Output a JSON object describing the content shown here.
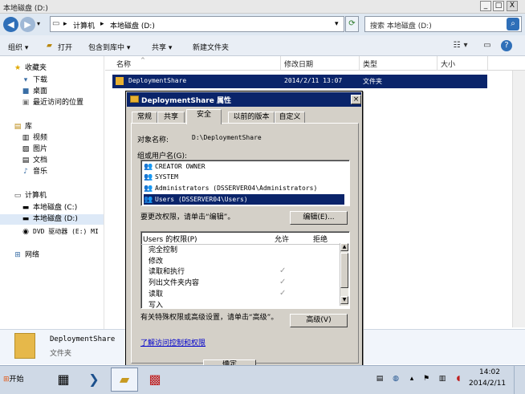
{
  "window": {
    "title": "本地磁盘 (D:)",
    "min": "_",
    "max": "□",
    "close": "X"
  },
  "address": {
    "crumbs": [
      "▸",
      "计算机",
      "▸",
      "本地磁盘 (D:)",
      "▾"
    ],
    "search_placeholder": "搜索 本地磁盘 (D:)"
  },
  "toolbar": {
    "organize": "组织 ▾",
    "open": "打开",
    "include": "包含到库中 ▾",
    "share": "共享 ▾",
    "new_folder": "新建文件夹"
  },
  "sidebar": {
    "favorites": "收藏夹",
    "fav_items": [
      "下载",
      "桌面",
      "最近访问的位置"
    ],
    "libraries": "库",
    "lib_items": [
      "视频",
      "图片",
      "文档",
      "音乐"
    ],
    "computer": "计算机",
    "drives": [
      "本地磁盘 (C:)",
      "本地磁盘 (D:)",
      "DVD 驱动器 (E:) MI"
    ],
    "network": "网络"
  },
  "columns": {
    "name": "名称",
    "date": "修改日期",
    "type": "类型",
    "size": "大小"
  },
  "file": {
    "name": "DeploymentShare",
    "date": "2014/2/11 13:07",
    "type": "文件夹"
  },
  "details": {
    "name": "DeploymentShare",
    "type": "文件夹"
  },
  "taskbar": {
    "start": "开始",
    "time": "14:02",
    "date": "2014/2/11"
  },
  "dialog": {
    "title": "DeploymentShare 属性",
    "tabs": [
      "常规",
      "共享",
      "安全",
      "以前的版本",
      "自定义"
    ],
    "object_label": "对象名称:",
    "object_value": "D:\\DeploymentShare",
    "group_label": "组或用户名(G):",
    "users": [
      "CREATOR OWNER",
      "SYSTEM",
      "Administrators (DSSERVER04\\Administrators)",
      "Users (DSSERVER04\\Users)"
    ],
    "change_hint": "要更改权限，请单击“编辑”。",
    "edit_button": "编辑(E)...",
    "perm_label": "Users 的权限(P)",
    "allow": "允许",
    "deny": "拒绝",
    "permissions": [
      {
        "name": "完全控制",
        "allow": false
      },
      {
        "name": "修改",
        "allow": false
      },
      {
        "name": "读取和执行",
        "allow": true
      },
      {
        "name": "列出文件夹内容",
        "allow": true
      },
      {
        "name": "读取",
        "allow": true
      },
      {
        "name": "写入",
        "allow": false
      }
    ],
    "special_hint": "有关特殊权限或高级设置，请单击“高级”。",
    "advanced_button": "高级(V)",
    "link": "了解访问控制和权限",
    "ok_button": "确定"
  }
}
